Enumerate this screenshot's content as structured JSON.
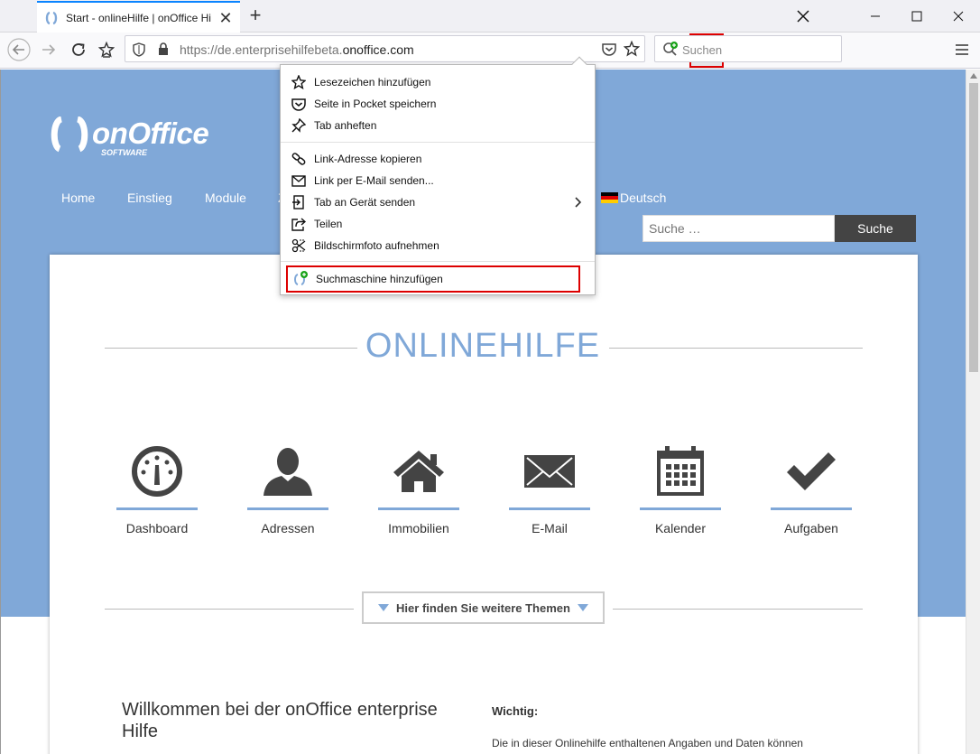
{
  "browser": {
    "tab_title": "Start - onlineHilfe | onOffice Hilfe",
    "url_prefix": "https://de.enterprisehilfebeta.",
    "url_domain": "onoffice.com",
    "search_placeholder": "Suchen"
  },
  "menu": {
    "items": [
      {
        "label": "Lesezeichen hinzufügen",
        "icon": "star-outline-icon"
      },
      {
        "label": "Seite in Pocket speichern",
        "icon": "pocket-icon"
      },
      {
        "label": "Tab anheften",
        "icon": "pin-icon"
      },
      {
        "label": "Link-Adresse kopieren",
        "icon": "link-icon"
      },
      {
        "label": "Link per E-Mail senden...",
        "icon": "envelope-icon"
      },
      {
        "label": "Tab an Gerät senden",
        "icon": "send-to-device-icon"
      },
      {
        "label": "Teilen",
        "icon": "share-icon"
      },
      {
        "label": "Bildschirmfoto aufnehmen",
        "icon": "screenshot-scissors-icon"
      },
      {
        "label": "Suchmaschine hinzufügen",
        "icon": "add-search-engine-icon"
      }
    ]
  },
  "site": {
    "logo_text": "onOffice",
    "logo_sub": "SOFTWARE",
    "nav": [
      "Home",
      "Einstieg",
      "Module",
      "Z"
    ],
    "lang": "Deutsch",
    "search_placeholder": "Suche …",
    "search_button": "Suche",
    "heading": "ONLINEHILFE",
    "tiles": [
      {
        "label": "Dashboard",
        "icon": "dashboard-gauge-icon"
      },
      {
        "label": "Adressen",
        "icon": "person-icon"
      },
      {
        "label": "Immobilien",
        "icon": "house-icon"
      },
      {
        "label": "E-Mail",
        "icon": "envelope-icon"
      },
      {
        "label": "Kalender",
        "icon": "calendar-icon"
      },
      {
        "label": "Aufgaben",
        "icon": "checkmark-icon"
      }
    ],
    "themes_button": "Hier finden Sie weitere Themen",
    "welcome_title": "Willkommen bei der onOffice enterprise Hilfe",
    "wichtig_title": "Wichtig:",
    "wichtig_text": "Die in dieser Onlinehilfe enthaltenen Angaben und Daten können"
  },
  "colors": {
    "accent": "#80a8d8",
    "highlight": "#dd0000",
    "firefox_blue": "#0a84ff"
  }
}
